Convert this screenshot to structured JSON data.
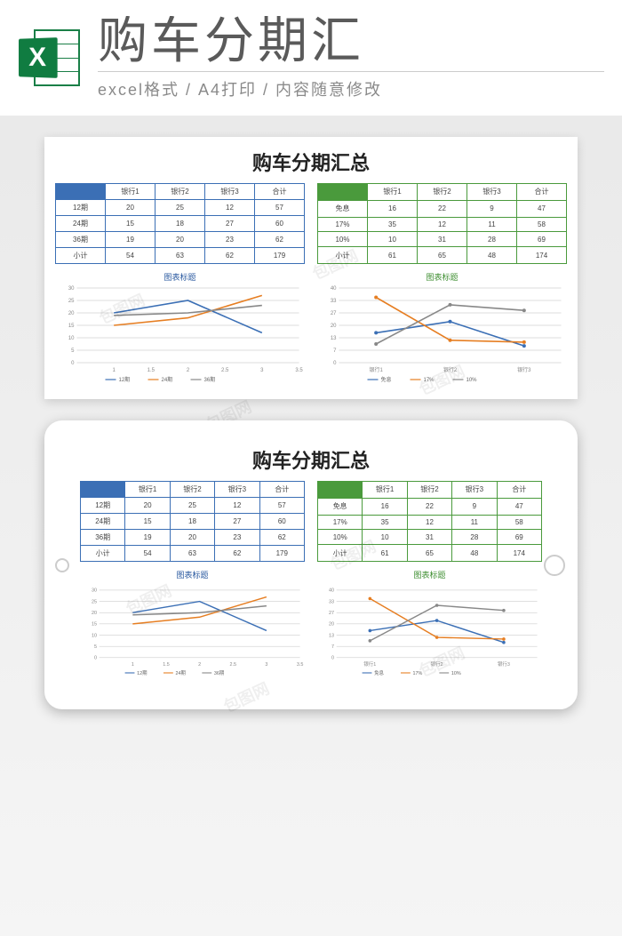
{
  "header": {
    "icon_letter": "X",
    "title": "购车分期汇",
    "subtitle": "excel格式 / A4打印 / 内容随意修改"
  },
  "sheet": {
    "title": "购车分期汇总",
    "table_blue": {
      "headers": [
        "",
        "银行1",
        "银行2",
        "银行3",
        "合计"
      ],
      "rows": [
        {
          "label": "12期",
          "cells": [
            "20",
            "25",
            "12",
            "57"
          ]
        },
        {
          "label": "24期",
          "cells": [
            "15",
            "18",
            "27",
            "60"
          ]
        },
        {
          "label": "36期",
          "cells": [
            "19",
            "20",
            "23",
            "62"
          ]
        },
        {
          "label": "小计",
          "cells": [
            "54",
            "63",
            "62",
            "179"
          ]
        }
      ]
    },
    "table_green": {
      "headers": [
        "",
        "银行1",
        "银行2",
        "银行3",
        "合计"
      ],
      "rows": [
        {
          "label": "免息",
          "cells": [
            "16",
            "22",
            "9",
            "47"
          ]
        },
        {
          "label": "17%",
          "cells": [
            "35",
            "12",
            "11",
            "58"
          ]
        },
        {
          "label": "10%",
          "cells": [
            "10",
            "31",
            "28",
            "69"
          ]
        },
        {
          "label": "小计",
          "cells": [
            "61",
            "65",
            "48",
            "174"
          ]
        }
      ]
    },
    "chart_left_title": "图表标题",
    "chart_right_title": "图表标题",
    "legend_left": [
      "12期",
      "24期",
      "36期"
    ],
    "legend_right": [
      "免息",
      "17%",
      "10%"
    ],
    "axis_right_categories": [
      "银行1",
      "银行2",
      "银行3"
    ]
  },
  "watermark_text": "包图网",
  "chart_data": [
    {
      "type": "line",
      "title": "图表标题",
      "xlabel": "",
      "ylabel": "",
      "x": [
        1,
        2,
        3
      ],
      "xlim": [
        0.5,
        3.5
      ],
      "ylim": [
        0,
        30
      ],
      "series": [
        {
          "name": "12期",
          "values": [
            20,
            25,
            12
          ],
          "color": "#3b6fb5"
        },
        {
          "name": "24期",
          "values": [
            15,
            18,
            27
          ],
          "color": "#e67e22"
        },
        {
          "name": "36期",
          "values": [
            19,
            20,
            23
          ],
          "color": "#888888"
        }
      ]
    },
    {
      "type": "line",
      "title": "图表标题",
      "xlabel": "",
      "ylabel": "",
      "categories": [
        "银行1",
        "银行2",
        "银行3"
      ],
      "ylim": [
        0,
        40
      ],
      "series": [
        {
          "name": "免息",
          "values": [
            16,
            22,
            9
          ],
          "color": "#3b6fb5"
        },
        {
          "name": "17%",
          "values": [
            35,
            12,
            11
          ],
          "color": "#e67e22"
        },
        {
          "name": "10%",
          "values": [
            10,
            31,
            28
          ],
          "color": "#888888"
        }
      ]
    }
  ]
}
